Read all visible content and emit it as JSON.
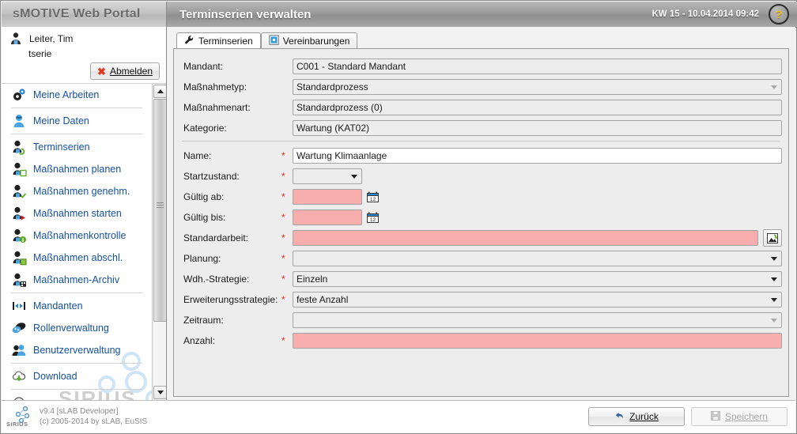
{
  "header": {
    "brand": "sMOTIVE Web Portal",
    "page_title": "Terminserien verwalten",
    "kw_datetime": "KW 15 - 10.04.2014 09:42",
    "help_glyph": "?"
  },
  "user": {
    "name": "Leiter, Tim",
    "login": "tserie",
    "logout_label_pre": "A",
    "logout_label_accesskey": "b",
    "logout_label_post": "melden",
    "logout_label": "Abmelden"
  },
  "sidebar": {
    "items": [
      {
        "label": "Meine Arbeiten",
        "icon": "gears-icon",
        "sep_after": true
      },
      {
        "label": "Meine Daten",
        "icon": "user-blue-icon",
        "sep_after": true
      },
      {
        "label": "Terminserien",
        "icon": "person-recurrence-icon",
        "sep_after": false
      },
      {
        "label": "Maßnahmen planen",
        "icon": "person-plan-icon",
        "sep_after": false
      },
      {
        "label": "Maßnahmen genehm.",
        "icon": "person-approve-icon",
        "sep_after": false
      },
      {
        "label": "Maßnahmen starten",
        "icon": "person-start-icon",
        "sep_after": false
      },
      {
        "label": "Maßnahmenkontrolle",
        "icon": "person-control-icon",
        "sep_after": false
      },
      {
        "label": "Maßnahmen abschl.",
        "icon": "person-complete-icon",
        "sep_after": false
      },
      {
        "label": "Maßnahmen-Archiv",
        "icon": "person-archive-icon",
        "sep_after": true
      },
      {
        "label": "Mandanten",
        "icon": "mandanten-icon",
        "sep_after": false
      },
      {
        "label": "Rollenverwaltung",
        "icon": "roles-icon",
        "sep_after": false
      },
      {
        "label": "Benutzerverwaltung",
        "icon": "users-icon",
        "sep_after": true
      },
      {
        "label": "Download",
        "icon": "download-cloud-icon",
        "sep_after": true
      }
    ],
    "watermark": "SIRIUS"
  },
  "tabs": [
    {
      "label": "Terminserien",
      "icon": "wrench-icon",
      "active": true
    },
    {
      "label": "Vereinbarungen",
      "icon": "agreement-icon",
      "active": false
    }
  ],
  "form": {
    "rows": [
      {
        "label": "Mandant:",
        "value": "C001 - Standard Mandant",
        "required": false,
        "style": "readonly",
        "control": "text"
      },
      {
        "label": "Maßnahmetyp:",
        "value": "Standardprozess",
        "required": false,
        "style": "readonly",
        "control": "select-dim"
      },
      {
        "label": "Maßnahmenart:",
        "value": "Standardprozess (0)",
        "required": false,
        "style": "readonly",
        "control": "text"
      },
      {
        "label": "Kategorie:",
        "value": "Wartung (KAT02)",
        "required": false,
        "style": "readonly",
        "control": "text"
      },
      {
        "label": "Name:",
        "value": "Wartung Klimaanlage",
        "required": true,
        "style": "white",
        "control": "text"
      },
      {
        "label": "Startzustand:",
        "value": "",
        "required": true,
        "style": "empty",
        "control": "select-small"
      },
      {
        "label": "Gültig ab:",
        "value": "",
        "required": true,
        "style": "required",
        "control": "date"
      },
      {
        "label": "Gültig bis:",
        "value": "",
        "required": true,
        "style": "required",
        "control": "date"
      },
      {
        "label": "Standardarbeit:",
        "value": "",
        "required": true,
        "style": "required",
        "control": "lookup"
      },
      {
        "label": "Planung:",
        "value": "",
        "required": true,
        "style": "empty",
        "control": "select"
      },
      {
        "label": "Wdh.-Strategie:",
        "value": "Einzeln",
        "required": true,
        "style": "empty",
        "control": "select"
      },
      {
        "label": "Erweiterungsstrategie:",
        "value": "feste Anzahl",
        "required": true,
        "style": "empty",
        "control": "select"
      },
      {
        "label": "Zeitraum:",
        "value": "",
        "required": false,
        "style": "empty",
        "control": "select-dim"
      },
      {
        "label": "Anzahl:",
        "value": "",
        "required": true,
        "style": "required",
        "control": "text"
      }
    ],
    "required_marker": "*",
    "divider_after_index": 3
  },
  "footer": {
    "logo_text": "SIRIUS",
    "version": "v9.4 [sLAB Developer]",
    "copyright": "(c) 2005-2014 by sLAB, EuSIS",
    "back_label": "Zurück",
    "save_label": "Speichern"
  },
  "colors": {
    "accent_link": "#14509e",
    "required_bg": "#f9aeae",
    "star": "#e2322a",
    "header_dark": "#9b9b9b",
    "help_mark": "#f5c400"
  }
}
